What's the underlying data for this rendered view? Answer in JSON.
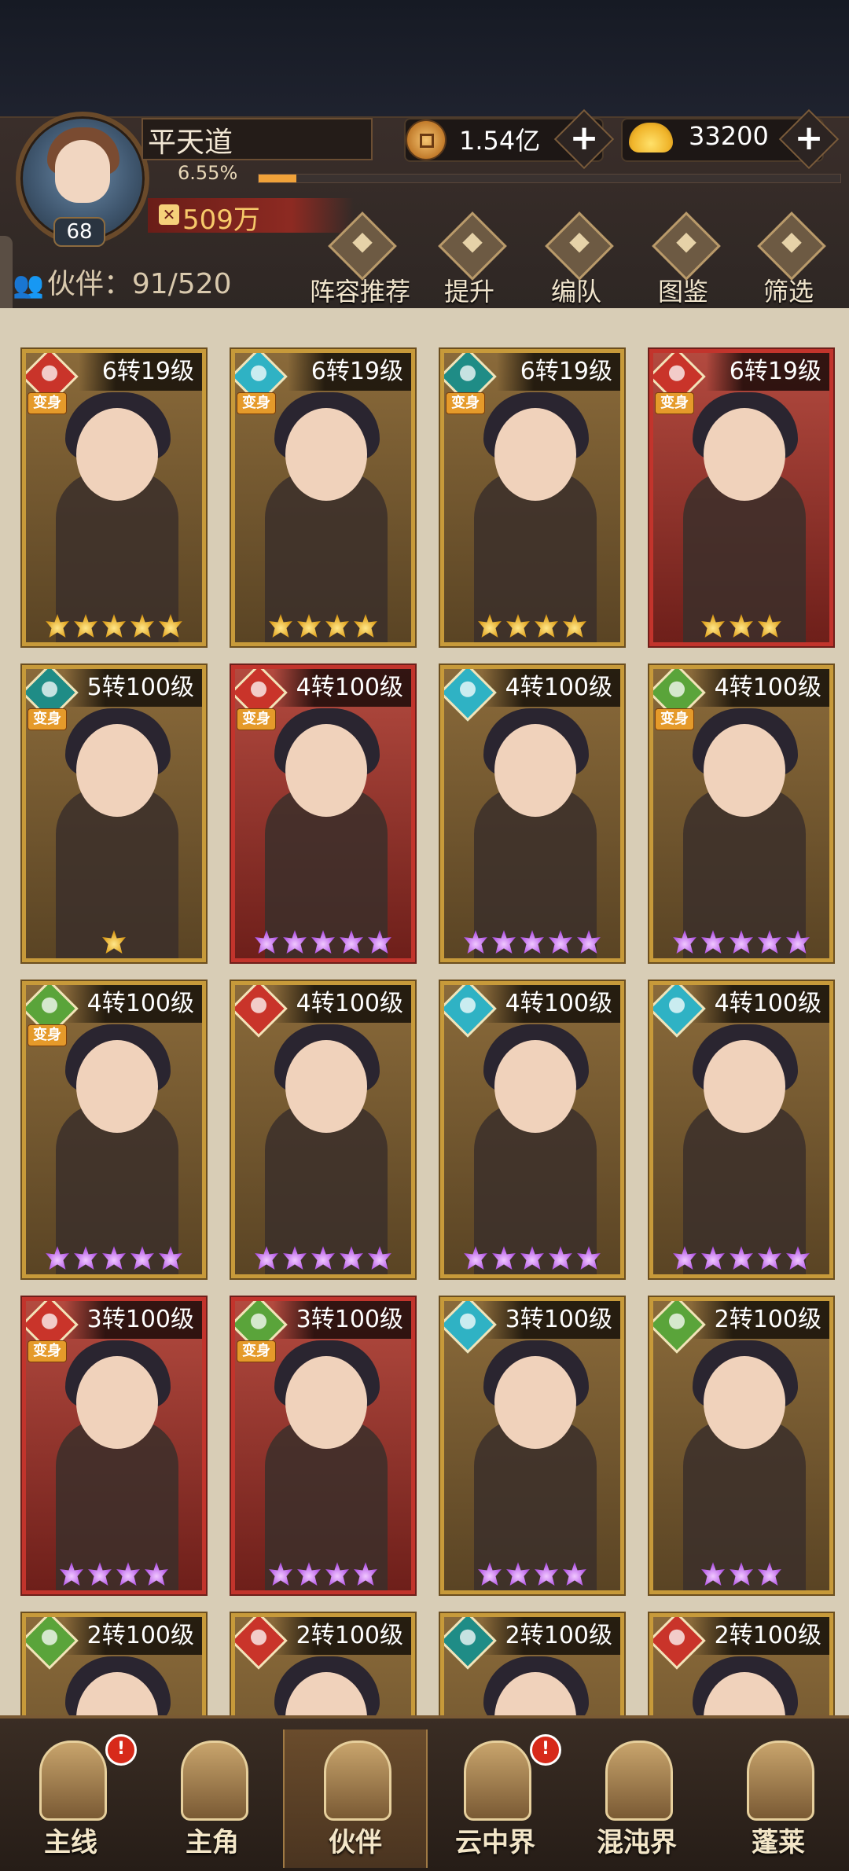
{
  "player": {
    "name": "平天道",
    "level": "68",
    "exp_percent_text": "6.55%",
    "exp_fraction": 0.0655,
    "power": "509万"
  },
  "currencies": [
    {
      "type": "copper-coin",
      "value": "1.54亿"
    },
    {
      "type": "gold-ingot",
      "value": "33200"
    }
  ],
  "partners": {
    "label": "伙伴：",
    "count": "91/520"
  },
  "menu": [
    {
      "label": "阵容推荐",
      "icon": "recommend-icon"
    },
    {
      "label": "提升",
      "icon": "upgrade-icon"
    },
    {
      "label": "编队",
      "icon": "formation-icon"
    },
    {
      "label": "图鉴",
      "icon": "codex-icon"
    },
    {
      "label": "筛选",
      "icon": "filter-icon"
    }
  ],
  "transform_badge": "变身",
  "cards": [
    {
      "level": "6转19级",
      "element": "red",
      "transform": true,
      "frame": "gold",
      "stars": 5,
      "star_color": "gold"
    },
    {
      "level": "6转19级",
      "element": "cyan",
      "transform": true,
      "frame": "gold",
      "stars": 4,
      "star_color": "gold"
    },
    {
      "level": "6转19级",
      "element": "teal",
      "transform": true,
      "frame": "gold",
      "stars": 4,
      "star_color": "gold"
    },
    {
      "level": "6转19级",
      "element": "red",
      "transform": true,
      "frame": "red",
      "stars": 3,
      "star_color": "gold"
    },
    {
      "level": "5转100级",
      "element": "teal",
      "transform": true,
      "frame": "gold",
      "stars": 1,
      "star_color": "gold"
    },
    {
      "level": "4转100级",
      "element": "red",
      "transform": true,
      "frame": "red",
      "stars": 5,
      "star_color": "purple"
    },
    {
      "level": "4转100级",
      "element": "cyan",
      "transform": false,
      "frame": "gold",
      "stars": 5,
      "star_color": "purple"
    },
    {
      "level": "4转100级",
      "element": "green",
      "transform": true,
      "frame": "gold",
      "stars": 5,
      "star_color": "purple"
    },
    {
      "level": "4转100级",
      "element": "green",
      "transform": true,
      "frame": "gold",
      "stars": 5,
      "star_color": "purple"
    },
    {
      "level": "4转100级",
      "element": "red",
      "transform": false,
      "frame": "gold",
      "stars": 5,
      "star_color": "purple"
    },
    {
      "level": "4转100级",
      "element": "cyan",
      "transform": false,
      "frame": "gold",
      "stars": 5,
      "star_color": "purple"
    },
    {
      "level": "4转100级",
      "element": "cyan",
      "transform": false,
      "frame": "gold",
      "stars": 5,
      "star_color": "purple"
    },
    {
      "level": "3转100级",
      "element": "red",
      "transform": true,
      "frame": "red",
      "stars": 4,
      "star_color": "purple"
    },
    {
      "level": "3转100级",
      "element": "green",
      "transform": true,
      "frame": "red",
      "stars": 4,
      "star_color": "purple"
    },
    {
      "level": "3转100级",
      "element": "cyan",
      "transform": false,
      "frame": "gold",
      "stars": 4,
      "star_color": "purple"
    },
    {
      "level": "2转100级",
      "element": "green",
      "transform": false,
      "frame": "gold",
      "stars": 3,
      "star_color": "purple"
    },
    {
      "level": "2转100级",
      "element": "green",
      "transform": false,
      "frame": "gold",
      "stars": 0,
      "star_color": "purple"
    },
    {
      "level": "2转100级",
      "element": "red",
      "transform": false,
      "frame": "gold",
      "stars": 0,
      "star_color": "purple"
    },
    {
      "level": "2转100级",
      "element": "teal",
      "transform": false,
      "frame": "gold",
      "stars": 0,
      "star_color": "purple"
    },
    {
      "level": "2转100级",
      "element": "red",
      "transform": false,
      "frame": "gold",
      "stars": 0,
      "star_color": "purple"
    }
  ],
  "element_colors": {
    "red": "#c9342a",
    "cyan": "#2fb2c4",
    "teal": "#1f8c86",
    "green": "#5aa43a"
  },
  "nav": [
    {
      "label": "主线",
      "icon": "main-quest-icon",
      "alert": true
    },
    {
      "label": "主角",
      "icon": "hero-icon",
      "alert": false
    },
    {
      "label": "伙伴",
      "icon": "partner-icon",
      "alert": false,
      "active": true
    },
    {
      "label": "云中界",
      "icon": "cloud-realm-icon",
      "alert": true
    },
    {
      "label": "混沌界",
      "icon": "chaos-realm-icon",
      "alert": false
    },
    {
      "label": "蓬莱",
      "icon": "penglai-icon",
      "alert": false
    }
  ],
  "alert_mark": "!"
}
